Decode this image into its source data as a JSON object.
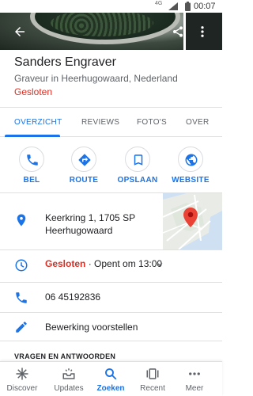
{
  "status_bar": {
    "network": "4G",
    "time": "00:07"
  },
  "place": {
    "name": "Sanders Engraver",
    "category": "Graveur in Heerhugowaard, Nederland",
    "status": "Gesloten"
  },
  "tabs": [
    {
      "label": "OVERZICHT",
      "active": true
    },
    {
      "label": "REVIEWS",
      "active": false
    },
    {
      "label": "FOTO'S",
      "active": false
    },
    {
      "label": "OVER",
      "active": false
    }
  ],
  "actions": [
    {
      "label": "BEL",
      "icon": "phone-icon"
    },
    {
      "label": "ROUTE",
      "icon": "directions-icon"
    },
    {
      "label": "OPSLAAN",
      "icon": "bookmark-icon"
    },
    {
      "label": "WEBSITE",
      "icon": "globe-icon"
    }
  ],
  "address": {
    "line1": "Keerkring 1, 1705 SP",
    "line2": "Heerhugowaard"
  },
  "hours": {
    "status": "Gesloten",
    "next": " · Opent om 13:00"
  },
  "phone": "06 45192836",
  "suggest_edit": "Bewerking voorstellen",
  "qa_header": "VRAGEN EN ANTWOORDEN",
  "bottom_nav": [
    {
      "label": "Discover",
      "icon": "discover-icon",
      "active": false
    },
    {
      "label": "Updates",
      "icon": "updates-icon",
      "active": false
    },
    {
      "label": "Zoeken",
      "icon": "search-icon",
      "active": true
    },
    {
      "label": "Recent",
      "icon": "recent-icon",
      "active": false
    },
    {
      "label": "Meer",
      "icon": "more-icon",
      "active": false
    }
  ],
  "colors": {
    "accent": "#1a73e8",
    "closed": "#d93025",
    "pin": "#ea4335"
  }
}
